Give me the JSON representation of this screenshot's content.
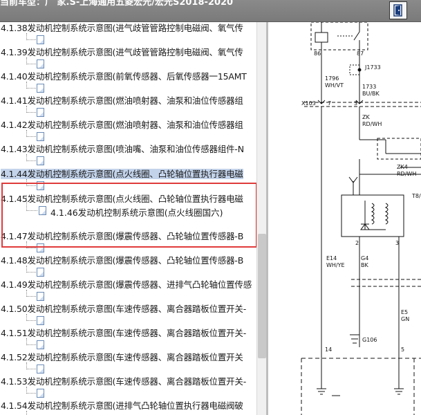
{
  "window": {
    "title": "当前车型：广 家.S-上海通用五菱宏光/宏光S2018-2020"
  },
  "tree": {
    "items": [
      {
        "label": "4.1.38发动机控制系统示意图(进气歧管管路控制电磁阀、氧气传"
      },
      {
        "label": "4.1.39发动机控制系统示意图(进气歧管管路控制电磁阀、氧气传"
      },
      {
        "label": "4.1.40发动机控制系统示意图(前氧传感器、后氧传感器一15AMT"
      },
      {
        "label": "4.1.41发动机控制系统示意图(燃油喷射器、油泵和油位传感器组"
      },
      {
        "label": "4.1.42发动机控制系统示意图(燃油喷射器、油泵和油位传感器组"
      },
      {
        "label": "4.1.43发动机控制系统示意图(喷油嘴、油泵和油位传感器组件-N"
      },
      {
        "label": "4.1.44发动机控制系统示意图(点火线圈、凸轮轴位置执行器电磁"
      },
      {
        "label": "4.1.45发动机控制系统示意图(点火线圈、凸轮轴位置执行器电磁"
      },
      {
        "label": "4.1.47发动机控制系统示意图(爆震传感器、凸轮轴位置传感器-B"
      },
      {
        "label": "4.1.48发动机控制系统示意图(爆震传感器、凸轮轴位置传感器-B"
      },
      {
        "label": "4.1.49发动机控制系统示意图(爆震传感器、进排气凸轮轴位置传感"
      },
      {
        "label": "4.1.50发动机控制系统示意图(车速传感器、离合器踏板位置开关-"
      },
      {
        "label": "4.1.51发动机控制系统示意图(车速传感器、离合器踏板位置开关-"
      },
      {
        "label": "4.1.52发动机控制系统示意图(车速传感器、离合器踏板位置开关"
      },
      {
        "label": "4.1.53发动机控制系统示意图(车速传感器、离合器踏板位置开关-"
      },
      {
        "label": "4.1.54发动机控制系统示意图(进排气凸轮轴位置执行器电磁阀破"
      }
    ],
    "subitem": {
      "label": "4.1.46发动机控制系统示意图(点火线圈国六)"
    }
  },
  "diagram": {
    "labels": {
      "pin86": "86",
      "pin87": "87",
      "w1796": "1796",
      "wvt": "WH/VT",
      "j1733": "J1733",
      "w1733": "1733",
      "wbu": "BU/BK",
      "x103": "X103",
      "p7": "7",
      "p3": "3",
      "zk": "ZK",
      "rdwh": "RD/WH",
      "zk4": "ZK4",
      "rdwh2": "RD/WH",
      "t8": "T8/",
      "p2": "2",
      "p3b": "3",
      "e14": "E14",
      "whye": "WH/YE",
      "g4": "G4",
      "bk": "BK",
      "e5": "E5",
      "gn": "GN",
      "g106": "G106",
      "p14": "14",
      "p5": "5"
    }
  }
}
